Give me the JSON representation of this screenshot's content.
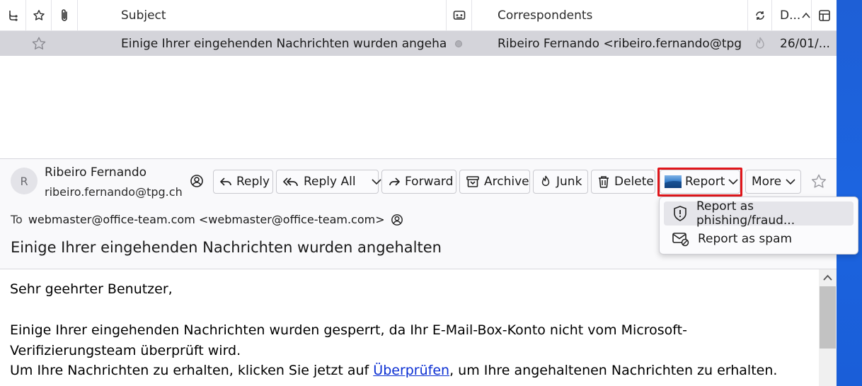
{
  "thread": {
    "columns": {
      "subject": "Subject",
      "correspondents": "Correspondents",
      "date": "D..."
    },
    "message": {
      "subject": "Einige Ihrer eingehenden Nachrichten wurden angehalten",
      "correspondent": "Ribeiro Fernando <ribeiro.fernando@tpg....",
      "date": "26/01/..."
    }
  },
  "header": {
    "avatar_initial": "R",
    "sender_name": "Ribeiro Fernando",
    "sender_email": "ribeiro.fernando@tpg.ch",
    "buttons": {
      "reply": "Reply",
      "reply_all": "Reply All",
      "forward": "Forward",
      "archive": "Archive",
      "junk": "Junk",
      "delete": "Delete",
      "report": "Report",
      "more": "More"
    },
    "to_label": "To",
    "to_value": "webmaster@office-team.com <webmaster@office-team.com>",
    "subject": "Einige Ihrer eingehenden Nachrichten wurden angehalten"
  },
  "report_menu": {
    "items": [
      {
        "label": "Report as phishing/fraud..."
      },
      {
        "label": "Report as spam"
      }
    ]
  },
  "body": {
    "greeting": "Sehr geehrter Benutzer,",
    "line1": "Einige Ihrer eingehenden Nachrichten wurden gesperrt, da Ihr E-Mail-Box-Konto nicht vom Microsoft-",
    "line2": "Verifizierungsteam überprüft wird.",
    "line3_before": "Um Ihre Nachrichten zu erhalten, klicken Sie jetzt auf ",
    "link": "Überprüfen",
    "line3_after": ", um Ihre angehaltenen Nachrichten zu erhalten."
  },
  "icons": {
    "thread": "thread-icon",
    "star": "star-icon",
    "attachment": "paperclip-icon",
    "spam": "spam-icon",
    "read": "read-status-icon",
    "sort": "sort-arrow-icon",
    "column_picker": "column-picker-icon"
  }
}
